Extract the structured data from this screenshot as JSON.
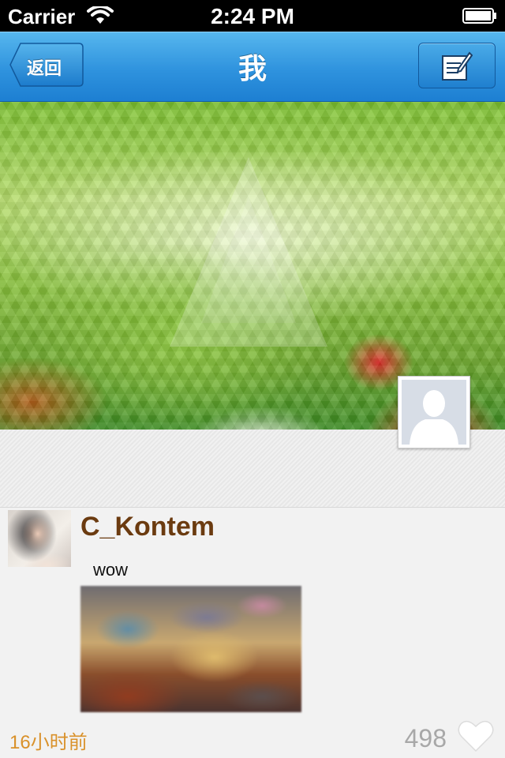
{
  "status_bar": {
    "carrier": "Carrier",
    "time": "2:24 PM",
    "wifi_icon": "wifi-icon",
    "battery_icon": "battery-icon"
  },
  "nav": {
    "back_label": "返回",
    "title": "我",
    "compose_icon": "compose-icon",
    "accent_color": "#2f93de"
  },
  "profile": {
    "cover_description_icon": "cover-image",
    "avatar_icon": "default-user-icon"
  },
  "post": {
    "author": "C_Kontem",
    "text": "wow",
    "time_ago": "16小时前",
    "like_count": "498",
    "like_icon": "heart-icon"
  }
}
